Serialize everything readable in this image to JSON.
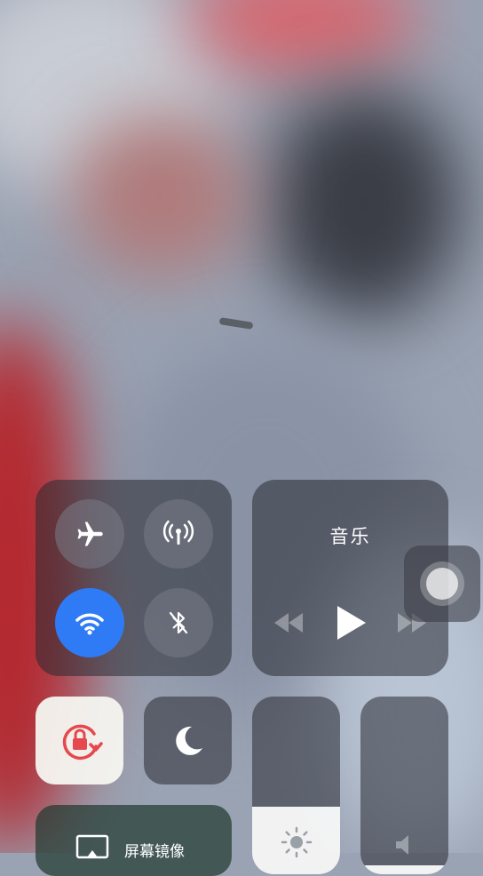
{
  "background": {
    "description_colors": [
      "#c9323a",
      "#3b3f4a",
      "#9aa3b3"
    ]
  },
  "connectivity": {
    "airplane_mode": false,
    "cellular_data": false,
    "wifi": true,
    "bluetooth": false,
    "icons": [
      "airplane-icon",
      "cellular-antenna-icon",
      "wifi-icon",
      "bluetooth-off-icon"
    ]
  },
  "music": {
    "title": "音乐",
    "controls": [
      "previous-icon",
      "play-icon",
      "next-icon"
    ]
  },
  "toggles": {
    "rotation_lock": true,
    "do_not_disturb": false
  },
  "brightness": {
    "level": 0.38
  },
  "volume": {
    "level": 0.05
  },
  "screen_mirroring": {
    "label": "屏幕镜像"
  },
  "colors": {
    "accent": "#2f7bf5",
    "lock_red": "#e5484d"
  }
}
